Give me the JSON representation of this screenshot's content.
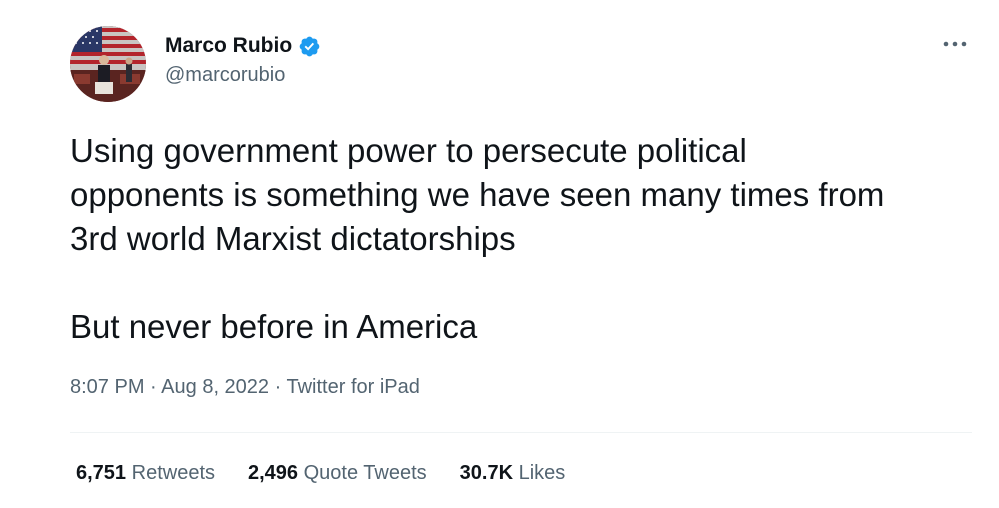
{
  "author": {
    "display_name": "Marco Rubio",
    "handle": "@marcorubio",
    "verified": true
  },
  "tweet": {
    "text": "Using government power to persecute political\nopponents is something we have seen many times from\n3rd world Marxist dictatorships\n\nBut never before in America"
  },
  "meta": {
    "time": "8:07 PM",
    "separator": "·",
    "date": "Aug 8, 2022",
    "source": "Twitter for iPad"
  },
  "stats": [
    {
      "count": "6,751",
      "label": "Retweets"
    },
    {
      "count": "2,496",
      "label": "Quote Tweets"
    },
    {
      "count": "30.7K",
      "label": "Likes"
    }
  ],
  "icons": {
    "verified": "verified-badge-icon",
    "more": "more-options-icon"
  },
  "colors": {
    "text": "#0f1419",
    "secondary": "#536471",
    "verified_blue": "#1d9bf0",
    "divider": "#eff3f4"
  }
}
